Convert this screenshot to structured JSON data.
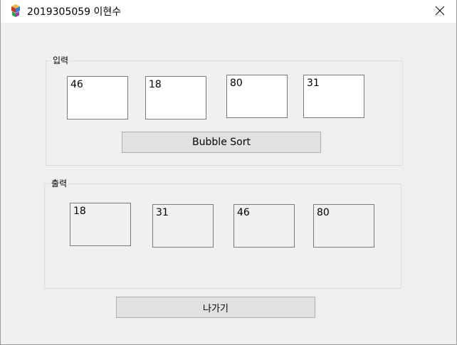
{
  "window": {
    "title": "2019305059 이현수"
  },
  "icons": {
    "app": "app-icon",
    "close": "close-icon"
  },
  "input_group": {
    "label": "입력",
    "values": [
      "46",
      "18",
      "80",
      "31"
    ]
  },
  "sort_button": {
    "label": "Bubble Sort"
  },
  "output_group": {
    "label": "출력",
    "values": [
      "18",
      "31",
      "46",
      "80"
    ]
  },
  "exit_button": {
    "label": "나가기"
  },
  "colors": {
    "window_bg": "#f0f0f0",
    "titlebar_bg": "#ffffff",
    "button_bg": "#e1e1e1",
    "textbox_border": "#7a7a7a"
  }
}
